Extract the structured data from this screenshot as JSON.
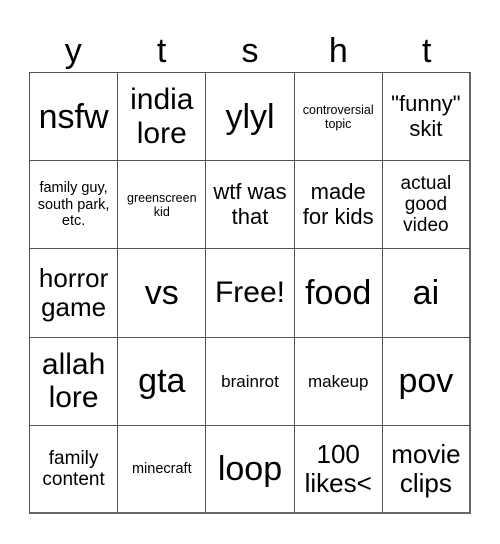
{
  "header": {
    "letters": [
      "y",
      "t",
      "s",
      "h",
      "t"
    ]
  },
  "cells": [
    [
      "nsfw",
      "india lore",
      "ylyl",
      "controversial topic",
      "\"funny\" skit"
    ],
    [
      "family guy, south park, etc.",
      "greenscreen kid",
      "wtf was that",
      "made for kids",
      "actual good video"
    ],
    [
      "horror game",
      "vs",
      "Free!",
      "food",
      "ai"
    ],
    [
      "allah lore",
      "gta",
      "brainrot",
      "makeup",
      "pov"
    ],
    [
      "family content",
      "minecraft",
      "loop",
      "100 likes<",
      "movie clips"
    ]
  ],
  "colors": {
    "border": "#555555",
    "text": "#000000",
    "background": "#ffffff"
  }
}
